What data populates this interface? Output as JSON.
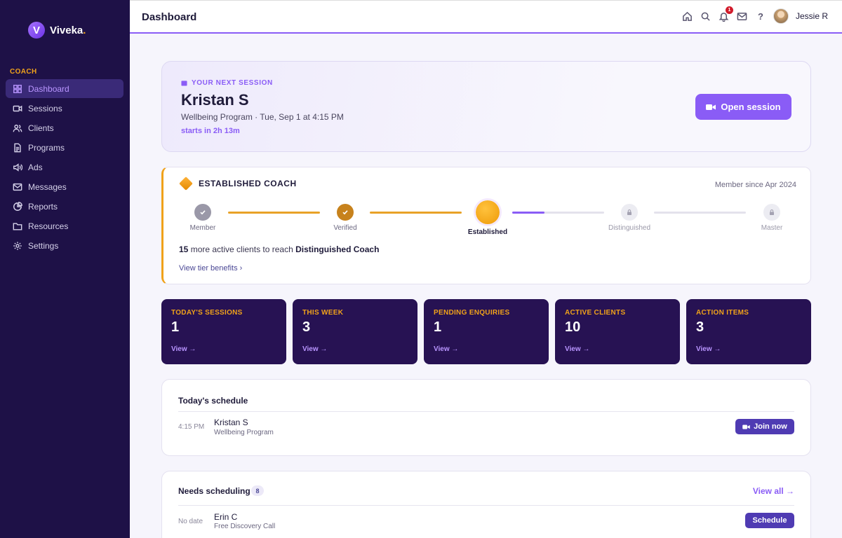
{
  "brand": {
    "logo_letter": "V",
    "name": "Viveka",
    "dot": "."
  },
  "sidebar": {
    "section_label": "COACH",
    "items": [
      {
        "label": "Dashboard",
        "icon": "grid-icon",
        "active": true
      },
      {
        "label": "Sessions",
        "icon": "video-icon"
      },
      {
        "label": "Clients",
        "icon": "users-icon"
      },
      {
        "label": "Programs",
        "icon": "document-icon"
      },
      {
        "label": "Ads",
        "icon": "speaker-icon"
      },
      {
        "label": "Messages",
        "icon": "mail-icon"
      },
      {
        "label": "Reports",
        "icon": "pie-chart-icon"
      },
      {
        "label": "Resources",
        "icon": "folder-icon"
      },
      {
        "label": "Settings",
        "icon": "gear-icon"
      }
    ]
  },
  "header": {
    "title": "Dashboard",
    "notification_count": "1",
    "help": "?",
    "user_name": "Jessie R"
  },
  "next_session": {
    "label": "YOUR NEXT SESSION",
    "client_name": "Kristan S",
    "detail": "Wellbeing Program · Tue, Sep 1 at 4:15 PM",
    "starts_in": "starts in 2h 13m",
    "button_label": "Open session"
  },
  "tier": {
    "title": "ESTABLISHED COACH",
    "member_since": "Member since Apr 2024",
    "steps": [
      {
        "label": "Member",
        "state": "done"
      },
      {
        "label": "Verified",
        "state": "done"
      },
      {
        "label": "Established",
        "state": "current"
      },
      {
        "label": "Distinguished",
        "state": "locked"
      },
      {
        "label": "Master",
        "state": "locked"
      }
    ],
    "next_tier_progress": 0.35,
    "progress_count": "15",
    "progress_text": " more active clients to reach ",
    "progress_target": "Distinguished Coach",
    "link_label": "View tier benefits ›",
    "colors": {
      "gold": "#f0a21a",
      "purple": "#8a5cf6"
    }
  },
  "stats": [
    {
      "label": "TODAY'S SESSIONS",
      "value": "1",
      "link": "View →"
    },
    {
      "label": "THIS WEEK",
      "value": "3",
      "link": "View →"
    },
    {
      "label": "PENDING ENQUIRIES",
      "value": "1",
      "link": "View →"
    },
    {
      "label": "ACTIVE CLIENTS",
      "value": "10",
      "link": "View →"
    },
    {
      "label": "ACTION ITEMS",
      "value": "3",
      "link": "View →"
    }
  ],
  "schedule": {
    "title": "Today's schedule",
    "rows": [
      {
        "time": "4:15 PM",
        "name": "Kristan S",
        "program": "Wellbeing Program",
        "action": "Join now"
      }
    ]
  },
  "needs_scheduling": {
    "title": "Needs scheduling",
    "count": "8",
    "view_all": "View all →",
    "rows": [
      {
        "date": "No date",
        "name": "Erin C",
        "program": "Free Discovery Call",
        "action": "Schedule"
      }
    ]
  }
}
